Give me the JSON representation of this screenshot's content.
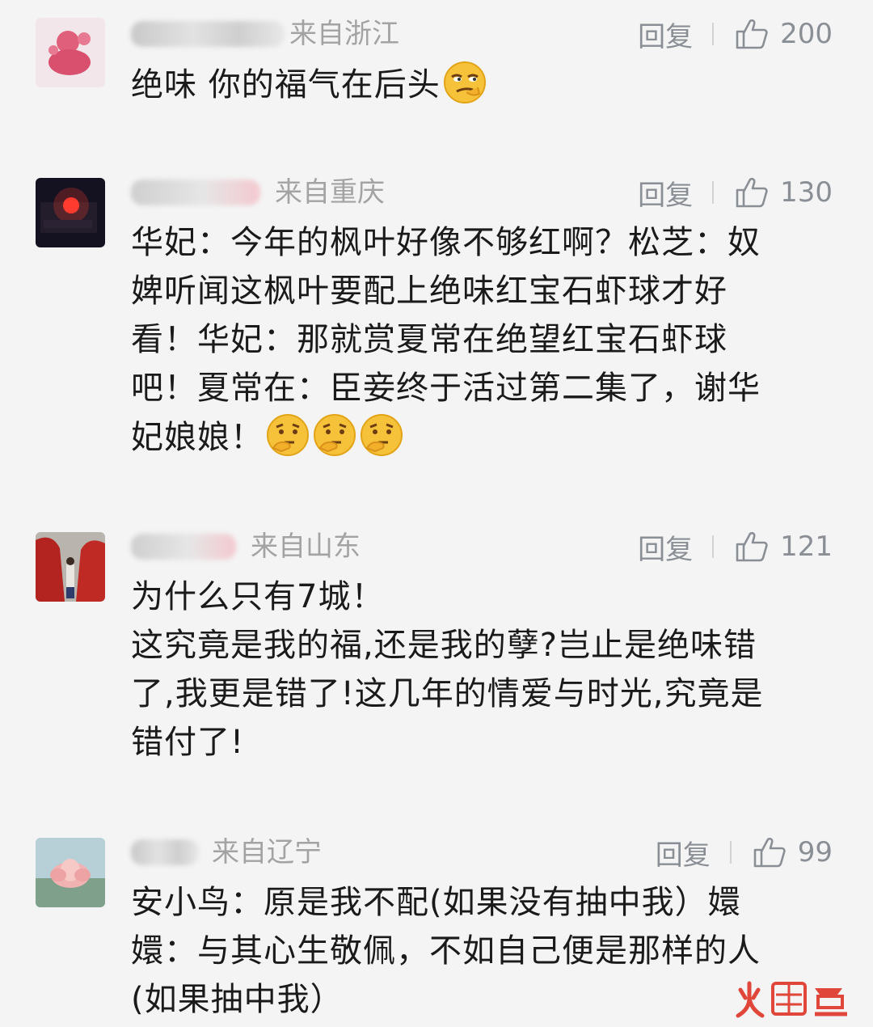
{
  "comments": [
    {
      "region": "来自浙江",
      "reply_label": "回复",
      "likes": "200",
      "text": "绝味 你的福气在后头"
    },
    {
      "region": "来自重庆",
      "reply_label": "回复",
      "likes": "130",
      "text": "华妃：今年的枫叶好像不够红啊？松芝：奴\n婢听闻这枫叶要配上绝味红宝石虾球才好\n看！华妃：那就赏夏常在绝望红宝石虾球\n吧！夏常在：臣妾终于活过第二集了，谢华\n妃娘娘！"
    },
    {
      "region": "来自山东",
      "reply_label": "回复",
      "likes": "121",
      "text": "为什么只有7城！\n这究竟是我的福,还是我的孽?岂止是绝味错\n了,我更是错了!这几年的情爱与时光,究竟是\n错付了!"
    },
    {
      "region": "来自辽宁",
      "reply_label": "回复",
      "likes": "99",
      "text": "安小鸟：原是我不配(如果没有抽中我）嬛\n嬛：与其心生敬佩，不如自己便是那样的人\n(如果抽中我）"
    }
  ],
  "icons": {
    "like": "thumbs-up-icon",
    "emoji_1": "smirk-face-emoji",
    "emoji_2": "thinking-face-emoji"
  },
  "colors": {
    "background": "#f4f4f4",
    "text": "#1a1a1a",
    "meta": "#9a9a9a",
    "action": "#8a8f96",
    "watermark": "#e0463a"
  }
}
